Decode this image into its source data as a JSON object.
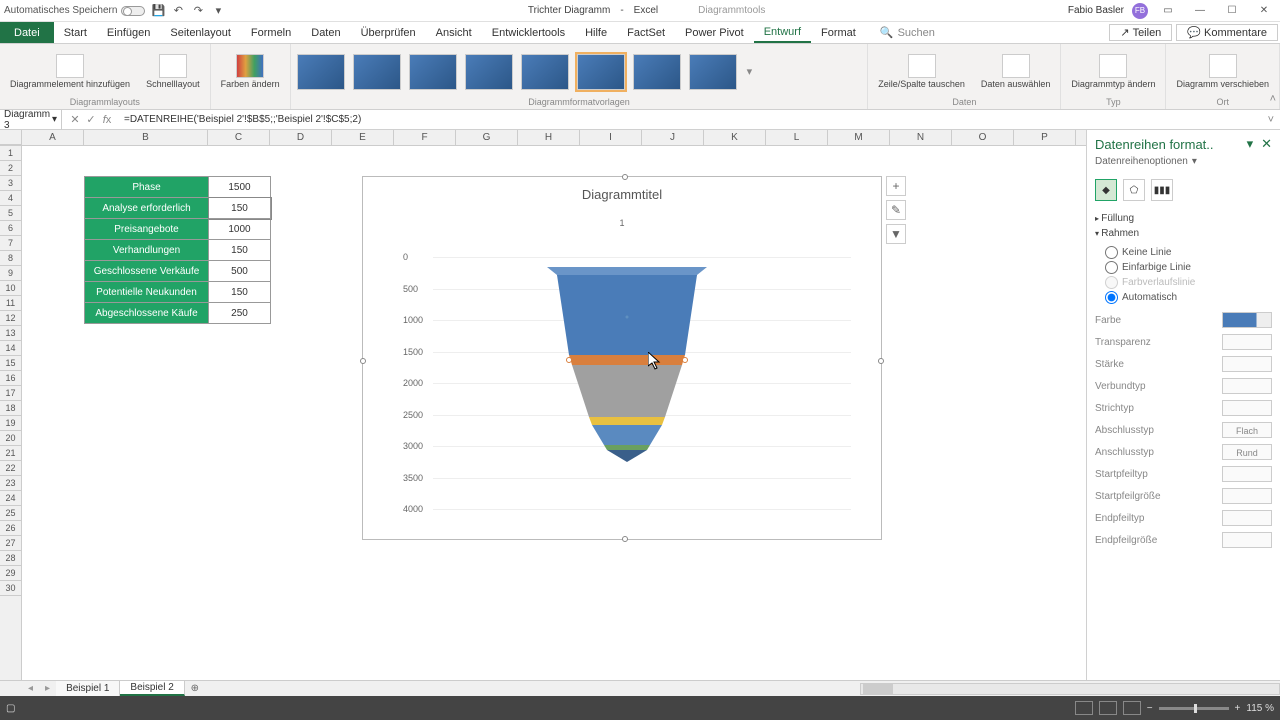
{
  "titlebar": {
    "autosave": "Automatisches Speichern",
    "docname": "Trichter Diagramm",
    "appname": "Excel",
    "tooltab": "Diagrammtools",
    "username": "Fabio Basler",
    "avatar": "FB"
  },
  "ribbon": {
    "tabs": [
      "Datei",
      "Start",
      "Einfügen",
      "Seitenlayout",
      "Formeln",
      "Daten",
      "Überprüfen",
      "Ansicht",
      "Entwicklertools",
      "Hilfe",
      "FactSet",
      "Power Pivot",
      "Entwurf",
      "Format"
    ],
    "active": "Entwurf",
    "search": "Suchen",
    "share": "Teilen",
    "comments": "Kommentare",
    "groups": {
      "layouts": "Diagrammlayouts",
      "styles": "Diagrammformatvorlagen",
      "data": "Daten",
      "type": "Typ",
      "loc": "Ort",
      "addel": "Diagrammelement hinzufügen",
      "quick": "Schnelllayout",
      "colors": "Farben ändern",
      "switch": "Zeile/Spalte tauschen",
      "select": "Daten auswählen",
      "change": "Diagrammtyp ändern",
      "move": "Diagramm verschieben"
    }
  },
  "formula": {
    "name": "Diagramm 3",
    "fx": "=DATENREIHE('Beispiel 2'!$B$5;;'Beispiel 2'!$C$5;2)"
  },
  "cols": [
    "A",
    "B",
    "C",
    "D",
    "E",
    "F",
    "G",
    "H",
    "I",
    "J",
    "K",
    "L",
    "M",
    "N",
    "O",
    "P"
  ],
  "table": {
    "rows": [
      {
        "label": "Phase",
        "val": "1500"
      },
      {
        "label": "Analyse erforderlich",
        "val": "150"
      },
      {
        "label": "Preisangebote",
        "val": "1000"
      },
      {
        "label": "Verhandlungen",
        "val": "150"
      },
      {
        "label": "Geschlossene Verkäufe",
        "val": "500"
      },
      {
        "label": "Potentielle Neukunden",
        "val": "150"
      },
      {
        "label": "Abgeschlossene Käufe",
        "val": "250"
      }
    ]
  },
  "chart_data": {
    "type": "funnel3d",
    "title": "Diagrammtitel",
    "legend": "1",
    "yticks": [
      "0",
      "500",
      "1000",
      "1500",
      "2000",
      "2500",
      "3000",
      "3500",
      "4000"
    ],
    "series": [
      {
        "name": "Phase",
        "value": 1500,
        "color": "#4a7cb8"
      },
      {
        "name": "Analyse erforderlich",
        "value": 150,
        "color": "#d97f3d"
      },
      {
        "name": "Preisangebote",
        "value": 1000,
        "color": "#a0a0a0"
      },
      {
        "name": "Verhandlungen",
        "value": 150,
        "color": "#e8c040"
      },
      {
        "name": "Geschlossene Verkäufe",
        "value": 500,
        "color": "#5a8ac0"
      },
      {
        "name": "Potentielle Neukunden",
        "value": 150,
        "color": "#6aa060"
      },
      {
        "name": "Abgeschlossene Käufe",
        "value": 250,
        "color": "#3a5f8a"
      }
    ]
  },
  "fpane": {
    "title": "Datenreihen format..",
    "options": "Datenreihenoptionen",
    "fill": "Füllung",
    "border": "Rahmen",
    "noline": "Keine Linie",
    "solid": "Einfarbige Linie",
    "grad": "Farbverlaufslinie",
    "auto": "Automatisch",
    "color": "Farbe",
    "transp": "Transparenz",
    "width": "Stärke",
    "compound": "Verbundtyp",
    "dash": "Strichtyp",
    "cap": "Abschlusstyp",
    "capval": "Flach",
    "join": "Anschlusstyp",
    "joinval": "Rund",
    "arrb": "Startpfeiltyp",
    "arrbs": "Startpfeilgröße",
    "arre": "Endpfeiltyp",
    "arres": "Endpfeilgröße"
  },
  "sheets": {
    "s1": "Beispiel 1",
    "s2": "Beispiel 2"
  },
  "status": {
    "zoom": "115 %"
  }
}
